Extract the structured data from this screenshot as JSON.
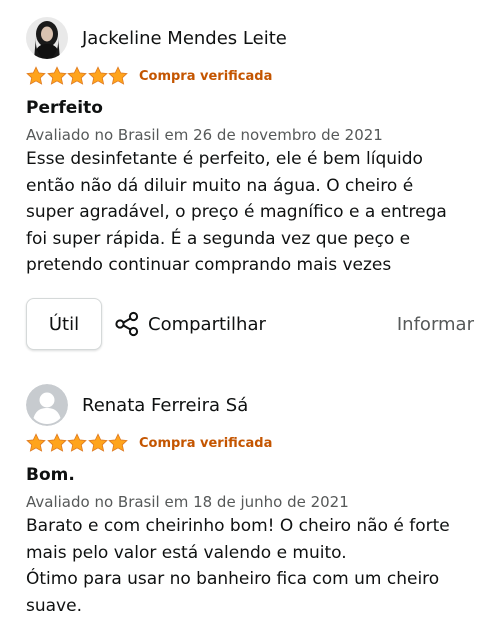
{
  "colors": {
    "star": "#ffa41c",
    "verified": "#c45500",
    "secondary_text": "#565959",
    "primary_text": "#0f1111"
  },
  "reviews": [
    {
      "author": "Jackeline Mendes Leite",
      "avatar_icon": "profile-photo",
      "rating": 5,
      "rating_max": 5,
      "verified_label": "Compra verificada",
      "title": "Perfeito",
      "date": "Avaliado no Brasil em 26 de novembro de 2021",
      "body_lines": [
        "Esse desinfetante é perfeito, ele é bem líquido",
        "então não dá diluir muito na água. O cheiro é",
        "super agradável, o preço é magnífico e a entrega",
        "foi super rápida. É a segunda vez que peço e",
        "pretendo continuar comprando mais vezes"
      ],
      "actions": {
        "helpful_label": "Útil",
        "share_label": "Compartilhar",
        "share_icon": "share-icon",
        "report_label": "Informar"
      }
    },
    {
      "author": "Renata Ferreira Sá",
      "avatar_icon": "default-avatar-icon",
      "rating": 5,
      "rating_max": 5,
      "verified_label": "Compra verificada",
      "title": "Bom.",
      "date": "Avaliado no Brasil em 18 de junho de 2021",
      "body_lines": [
        "Barato e com cheirinho bom! O cheiro não é forte",
        "mais pelo valor está valendo e muito.",
        "Ótimo para usar no banheiro fica com um cheiro",
        "suave."
      ]
    }
  ]
}
